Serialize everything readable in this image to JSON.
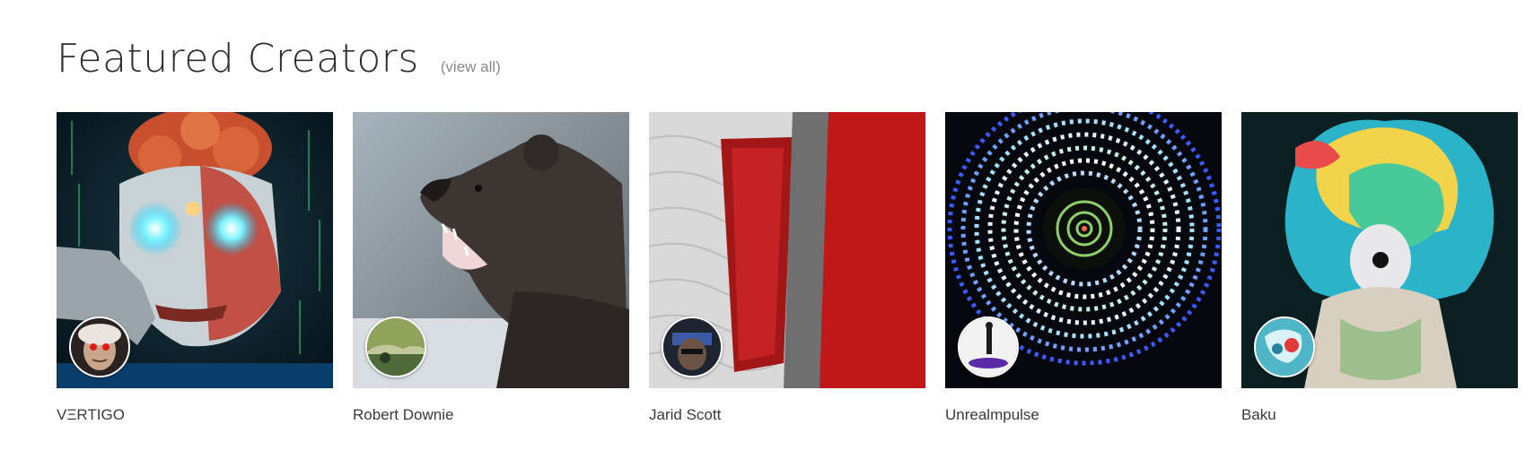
{
  "section": {
    "title": "Featured Creators",
    "view_all_label": "(view all)"
  },
  "creators": [
    {
      "name": "VΞRTIGO",
      "thumbnail_icon": "glowing-mask-artwork",
      "avatar_icon": "red-eyed-portrait-avatar"
    },
    {
      "name": "Robert Downie",
      "thumbnail_icon": "roaring-bear-photo",
      "avatar_icon": "landscape-avatar"
    },
    {
      "name": "Jarid Scott",
      "thumbnail_icon": "red-abstract-terrain-artwork",
      "avatar_icon": "dark-portrait-avatar"
    },
    {
      "name": "Unrealmpulse",
      "thumbnail_icon": "concentric-rings-artwork",
      "avatar_icon": "silhouette-figure-avatar"
    },
    {
      "name": "Baku",
      "thumbnail_icon": "colorful-smoke-figure-artwork",
      "avatar_icon": "teal-art-avatar"
    }
  ],
  "colors": {
    "title": "#2d2d2d",
    "link": "#8a8a8a",
    "name_text": "#3a3a3a"
  }
}
